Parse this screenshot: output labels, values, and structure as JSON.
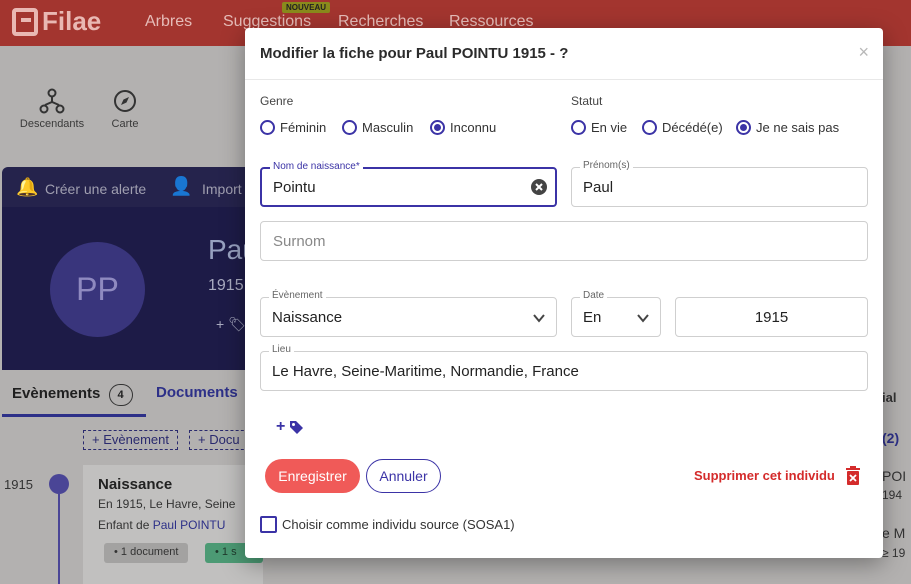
{
  "app": {
    "brand": "Filae",
    "nav": [
      {
        "label": "Arbres"
      },
      {
        "label": "Suggestions",
        "badge": "NOUVEAU"
      },
      {
        "label": "Recherches"
      },
      {
        "label": "Ressources"
      }
    ],
    "toolbar": [
      {
        "label": "Descendants",
        "icon": "tree-descendants-icon"
      },
      {
        "label": "Carte",
        "icon": "compass-icon"
      }
    ],
    "profile_actions": {
      "create_alert": "Créer une alerte",
      "import": "Import"
    },
    "profile": {
      "initials": "PP",
      "name_partial": "Pau",
      "year_partial": "1915",
      "tag_partial": "+"
    },
    "tabs": {
      "events_label": "Evènements",
      "events_count": "4",
      "documents_label": "Documents"
    },
    "add_buttons": {
      "event": "+ Evènement",
      "document": "+ Docu"
    },
    "timeline": {
      "year": "1915",
      "event_title": "Naissance",
      "event_desc": "En 1915, Le Havre, Seine",
      "child_of_prefix": "Enfant de ",
      "child_of_link": "Paul POINTU",
      "pill_doc": "• 1 document",
      "pill_source": "• 1 s"
    },
    "right_col": {
      "line1": "ial",
      "line2": "(2)",
      "line3": "POI",
      "line4": "194",
      "line5": "e M",
      "line6": "≥ 19"
    }
  },
  "modal": {
    "title": "Modifier la fiche pour Paul POINTU 1915 - ?",
    "close": "×",
    "genre": {
      "label": "Genre",
      "options": [
        "Féminin",
        "Masculin",
        "Inconnu"
      ],
      "selected": "Inconnu"
    },
    "statut": {
      "label": "Statut",
      "options": [
        "En vie",
        "Décédé(e)",
        "Je ne sais pas"
      ],
      "selected": "Je ne sais pas"
    },
    "fields": {
      "nom_label": "Nom de naissance*",
      "nom_value": "Pointu",
      "prenom_label": "Prénom(s)",
      "prenom_value": "Paul",
      "surnom_placeholder": "Surnom",
      "evenement_label": "Évènement",
      "evenement_value": "Naissance",
      "date_label": "Date",
      "date_qualifier": "En",
      "date_value": "1915",
      "lieu_label": "Lieu",
      "lieu_value": "Le Havre, Seine-Maritime, Normandie, France"
    },
    "tag_add": "+",
    "buttons": {
      "save": "Enregistrer",
      "cancel": "Annuler",
      "delete": "Supprimer cet individu"
    },
    "sosa_label": "Choisir comme individu source (SOSA1)",
    "colors": {
      "accent": "#3b33a6",
      "save": "#f05a58",
      "delete": "#d42b2b"
    }
  }
}
